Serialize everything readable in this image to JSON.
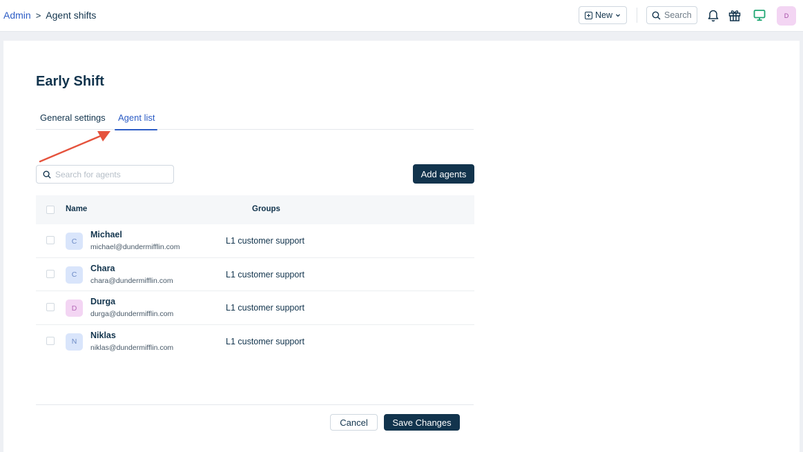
{
  "breadcrumb": {
    "root": "Admin",
    "separator": ">",
    "current": "Agent shifts"
  },
  "header": {
    "new_label": "New",
    "search_placeholder": "Search",
    "avatar_initial": "D",
    "icons": [
      "bell-icon",
      "gift-icon",
      "monitor-icon"
    ]
  },
  "page": {
    "title": "Early Shift"
  },
  "tabs": [
    {
      "label": "General settings",
      "active": false
    },
    {
      "label": "Agent list",
      "active": true
    }
  ],
  "agent_search": {
    "placeholder": "Search for agents"
  },
  "add_agents_label": "Add agents",
  "table": {
    "headers": {
      "name": "Name",
      "groups": "Groups"
    },
    "rows": [
      {
        "initial": "C",
        "name": "Michael",
        "email": "michael@dundermifflin.com",
        "group": "L1 customer support",
        "avatar_color": "blue"
      },
      {
        "initial": "C",
        "name": "Chara",
        "email": "chara@dundermifflin.com",
        "group": "L1 customer support",
        "avatar_color": "blue"
      },
      {
        "initial": "D",
        "name": "Durga",
        "email": "durga@dundermifflin.com",
        "group": "L1 customer support",
        "avatar_color": "pink"
      },
      {
        "initial": "N",
        "name": "Niklas",
        "email": "niklas@dundermifflin.com",
        "group": "L1 customer support",
        "avatar_color": "blue"
      }
    ]
  },
  "footer": {
    "cancel_label": "Cancel",
    "save_label": "Save Changes"
  },
  "colors": {
    "primary": "#12344d",
    "accent": "#2c5cc5",
    "annotation": "#e5533d"
  }
}
